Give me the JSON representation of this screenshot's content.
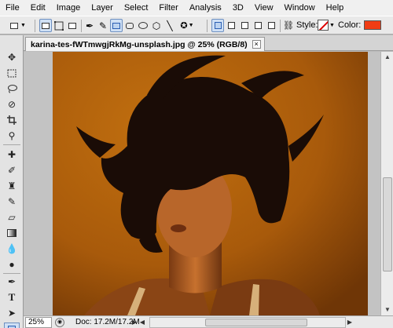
{
  "menu": [
    "File",
    "Edit",
    "Image",
    "Layer",
    "Select",
    "Filter",
    "Analysis",
    "3D",
    "View",
    "Window",
    "Help"
  ],
  "options_bar": {
    "style_label": "Style:",
    "color_label": "Color:",
    "color_value": "#f03c14"
  },
  "document": {
    "tab_title": "karina-tes-fWTmwgjRkMg-unsplash.jpg @ 25% (RGB/8)",
    "close_glyph": "×",
    "zoom": "25%",
    "doc_size": "Doc: 17.2M/17.2M"
  },
  "photo_colors": {
    "background": "#b5640a",
    "hair": "#1a0c06",
    "skin": "#c7712e"
  }
}
